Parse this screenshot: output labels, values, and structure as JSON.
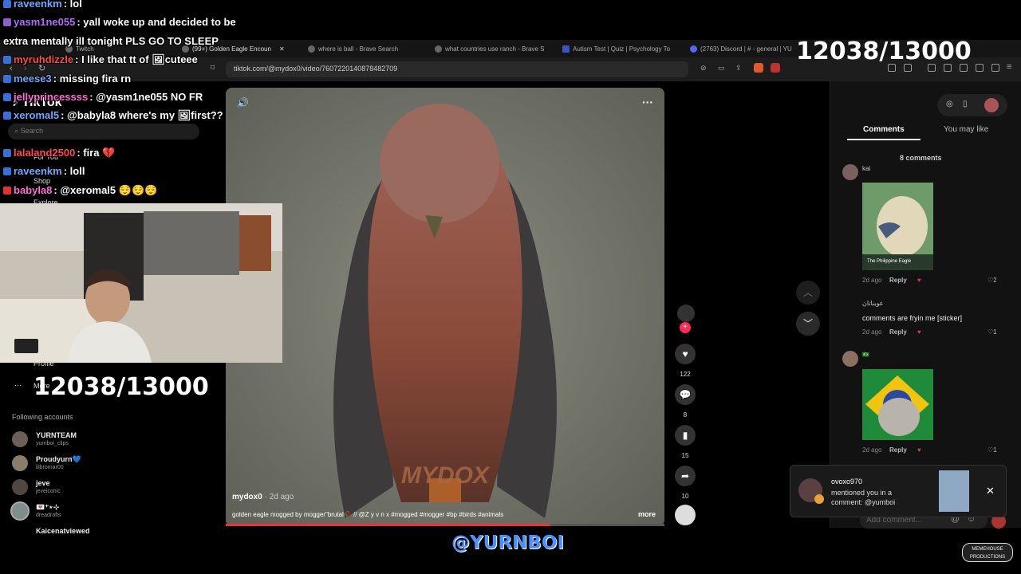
{
  "browser": {
    "tabs": [
      {
        "label": "Twitch"
      },
      {
        "label": "(99+) Golden Eagle Encoun",
        "active": true
      },
      {
        "label": "where is ball - Brave Search"
      },
      {
        "label": "what countries use ranch - Brave S"
      },
      {
        "label": "Autism Test | Quiz | Psychology To"
      },
      {
        "label": "(2763) Discord | # - general | YU"
      }
    ],
    "url": "tiktok.com/@mydox0/video/7607220140878482709"
  },
  "tiktok": {
    "logo": "TikTok",
    "search_placeholder": "Search",
    "nav": [
      "For You",
      "Shop",
      "Explore"
    ],
    "profile": "Profile",
    "more": "More",
    "following_header": "Following accounts",
    "following": [
      {
        "name": "YURNTEAM",
        "sub": "yurnboi_clips"
      },
      {
        "name": "Proudyurn💙",
        "sub": "lilbromar00"
      },
      {
        "name": "jeve",
        "sub": "jeveiconic"
      },
      {
        "name": "💌⁺⋆⊹",
        "sub": "dreadrafts"
      },
      {
        "name": "Kaicenatviewed",
        "sub": ""
      }
    ],
    "video": {
      "author": "mydox0",
      "age": "· 2d ago",
      "caption": "golden eagle mogged by mogger\"brutal🥀 // @Z y v n x  #mogged #mogger #bp #birds #animals",
      "more": "more",
      "watermark": "MYDOX",
      "progress": 0.74
    },
    "actions": {
      "likes": "122",
      "comments": "8",
      "saves": "15",
      "shares": "10"
    },
    "right": {
      "tabs": [
        "Comments",
        "You may like"
      ],
      "count": "8 comments",
      "comments": [
        {
          "user": "kai",
          "text": "",
          "image_caption": "The Philippine Eagle",
          "age": "2d ago",
          "reply": "Reply",
          "likes": "2"
        },
        {
          "user": "عوبناتان",
          "text": "comments are fryin me [sticker]",
          "age": "2d ago",
          "reply": "Reply",
          "likes": "1"
        },
        {
          "user": "🇧🇷",
          "text": "",
          "age": "2d ago",
          "reply": "Reply",
          "likes": "1"
        }
      ],
      "add_comment_placeholder": "Add comment..."
    },
    "notification": {
      "user": "ovoxo970",
      "text": "mentioned you in a comment: @yumboi"
    }
  },
  "chat": [
    {
      "user": "raveenkm",
      "color": "#6fa8ff",
      "msg": "lol"
    },
    {
      "user": "yasm1ne055",
      "color": "#b26bff",
      "msg": "yall woke up and decided to be"
    },
    {
      "user": "",
      "color": "#ffffff",
      "msg": "extra mentally ill tonight PLS GO TO SLEEP"
    },
    {
      "user": "myruhdizzle",
      "color": "#ff4b4b",
      "msg": "I like that tt of 🖼cuteee"
    },
    {
      "user": "meese3",
      "color": "#6fa8ff",
      "msg": "missing fira rn"
    },
    {
      "user": "jellyprincessss",
      "color": "#ff6bd6",
      "msg": "@yasm1ne055 NO FR"
    },
    {
      "user": "xeromal5",
      "color": "#6fa8ff",
      "msg": "@babyla8 where's my 🖼first??"
    },
    {
      "user": "lalaland2500",
      "color": "#ff4b4b",
      "msg": "fira 💔"
    },
    {
      "user": "raveenkm",
      "color": "#6fa8ff",
      "msg": "loll"
    },
    {
      "user": "babyla8",
      "color": "#ff6bd6",
      "msg": "@xeromal5 😌😌😌"
    }
  ],
  "overlay": {
    "counter": "12038/13000",
    "handle": "@YURNBOI",
    "watermark": "MEMEHOUSE PRODUCTIONS"
  },
  "colors": {
    "accent": "#fe2c55",
    "handle_blue": "#3b82f6"
  }
}
